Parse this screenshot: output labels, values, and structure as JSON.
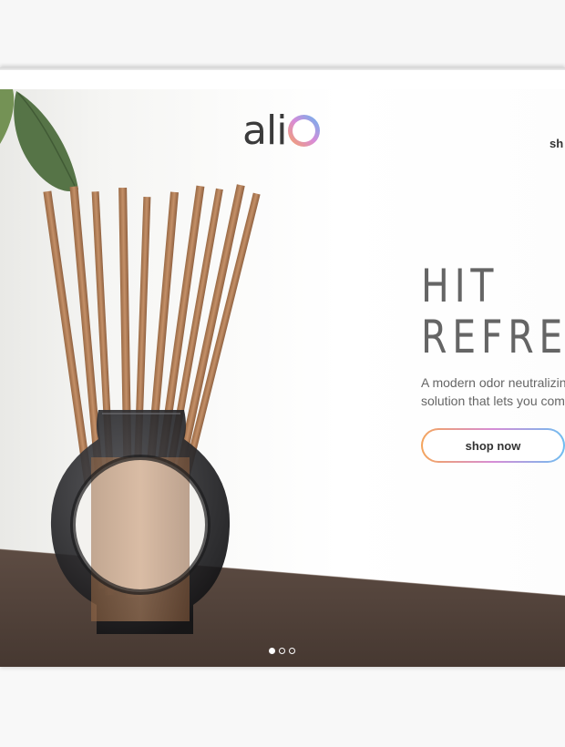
{
  "brand": {
    "logo_text": "ali",
    "logo_accent": "o"
  },
  "nav": {
    "shop_label": "sh"
  },
  "hero": {
    "headline_line1": "HIT",
    "headline_line2": "REFRE",
    "subcopy_line1": "A modern odor neutralizin",
    "subcopy_line2": "solution that lets you com",
    "cta_label": "shop now"
  },
  "carousel": {
    "slide_count": 3,
    "active_index": 0
  },
  "colors": {
    "text_dark": "#3b3b3b",
    "gradient_start": "#f4a55c",
    "gradient_mid": "#d68dd6",
    "gradient_end": "#6fbdf0"
  }
}
